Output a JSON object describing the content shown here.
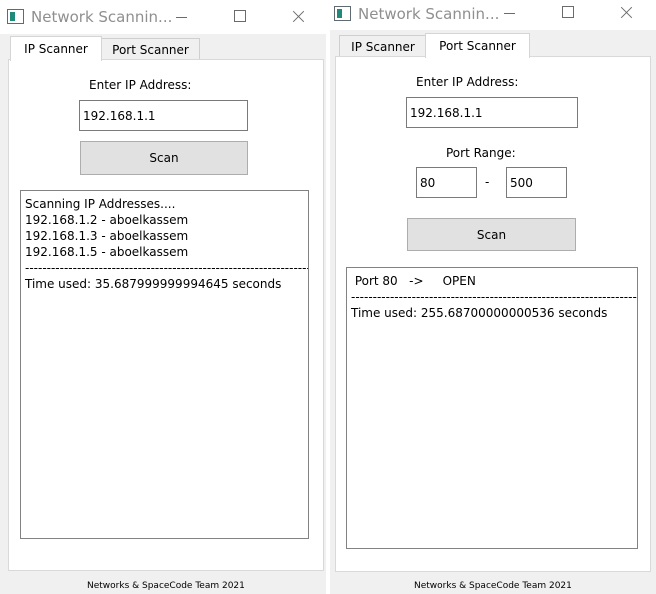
{
  "left_window": {
    "title": "Network Scannin...",
    "tabs": [
      {
        "label": "IP Scanner"
      },
      {
        "label": "Port Scanner"
      }
    ],
    "ip_label": "Enter IP Address:",
    "ip_value": "192.168.1.1",
    "scan_label": "Scan",
    "output_lines": [
      "Scanning IP Addresses....",
      "192.168.1.2 - aboelkassem",
      "192.168.1.3 - aboelkassem",
      "192.168.1.5 - aboelkassem",
      "------------------------------------------------------------------",
      "Time used: 35.687999999994645 seconds"
    ],
    "footer": "Networks & SpaceCode Team 2021"
  },
  "right_window": {
    "title": "Network Scannin...",
    "tabs": [
      {
        "label": "IP Scanner"
      },
      {
        "label": "Port Scanner"
      }
    ],
    "ip_label": "Enter IP Address:",
    "ip_value": "192.168.1.1",
    "port_range_label": "Port Range:",
    "port_from": "80",
    "port_sep": "-",
    "port_to": "500",
    "scan_label": "Scan",
    "output_lines": [
      " Port 80   ->     OPEN",
      "------------------------------------------------------------------",
      "Time used: 255.68700000000536 seconds"
    ],
    "footer": "Networks & SpaceCode Team 2021"
  }
}
